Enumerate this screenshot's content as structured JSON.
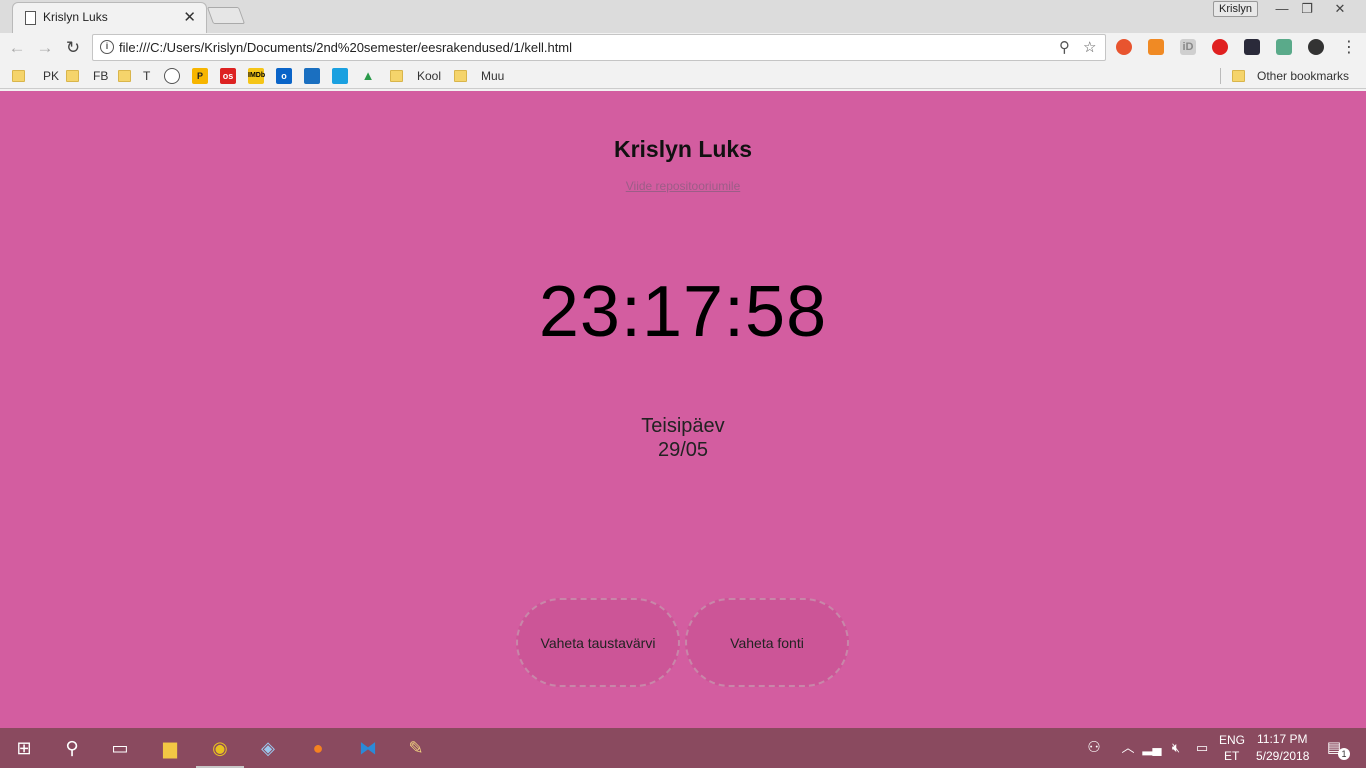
{
  "browser": {
    "tab_title": "Krislyn Luks",
    "profile_name": "Krislyn",
    "url": "file:///C:/Users/Krislyn/Documents/2nd%20semester/eesrakendused/1/kell.html",
    "bookmarks": [
      "PK",
      "FB",
      "T",
      "Kool",
      "Muu"
    ],
    "other_bookmarks": "Other bookmarks"
  },
  "page": {
    "name": "Krislyn Luks",
    "repo_link": "Viide repositooriumile",
    "time": "23:17:58",
    "weekday": "Teisipäev",
    "date": "29/05",
    "button_bg": "Vaheta taustavärvi",
    "button_font": "Vaheta fonti",
    "background_color": "#d35da0"
  },
  "taskbar": {
    "lang": "ENG",
    "layout": "ET",
    "time": "11:17 PM",
    "date": "5/29/2018",
    "notifications": "1"
  }
}
